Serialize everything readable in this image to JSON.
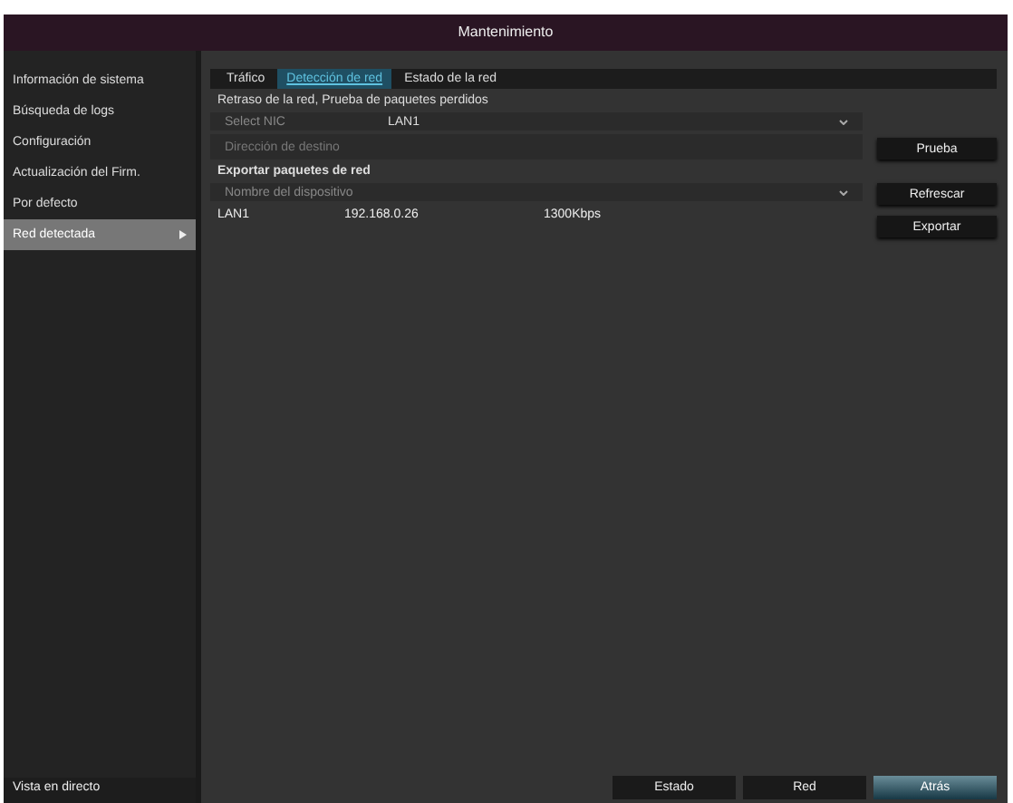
{
  "window": {
    "title": "Mantenimiento"
  },
  "sidebar": {
    "items": [
      {
        "label": "Información de sistema",
        "selected": false
      },
      {
        "label": "Búsqueda de logs",
        "selected": false
      },
      {
        "label": "Configuración",
        "selected": false
      },
      {
        "label": "Actualización del Firm.",
        "selected": false
      },
      {
        "label": "Por defecto",
        "selected": false
      },
      {
        "label": "Red detectada",
        "selected": true
      }
    ],
    "footer": "Vista en directo"
  },
  "tabs": [
    {
      "label": "Tráfico",
      "selected": false
    },
    {
      "label": "Detección de red",
      "selected": true
    },
    {
      "label": "Estado de la red",
      "selected": false
    }
  ],
  "test_section": {
    "title": "Retraso de la red, Prueba de paquetes perdidos",
    "nic_label": "Select NIC",
    "nic_value": "LAN1",
    "destination_placeholder": "Dirección de destino",
    "button": "Prueba"
  },
  "export_section": {
    "title": "Exportar paquetes de red",
    "device_placeholder": "Nombre del dispositivo",
    "buttons": [
      "Refrescar",
      "Exportar"
    ],
    "rows": [
      {
        "name": "LAN1",
        "ip": "192.168.0.26",
        "speed": "1300Kbps"
      }
    ]
  },
  "bottom_buttons": [
    {
      "label": "Estado",
      "selected": false
    },
    {
      "label": "Red",
      "selected": false
    },
    {
      "label": "Atrás",
      "selected": true
    }
  ]
}
